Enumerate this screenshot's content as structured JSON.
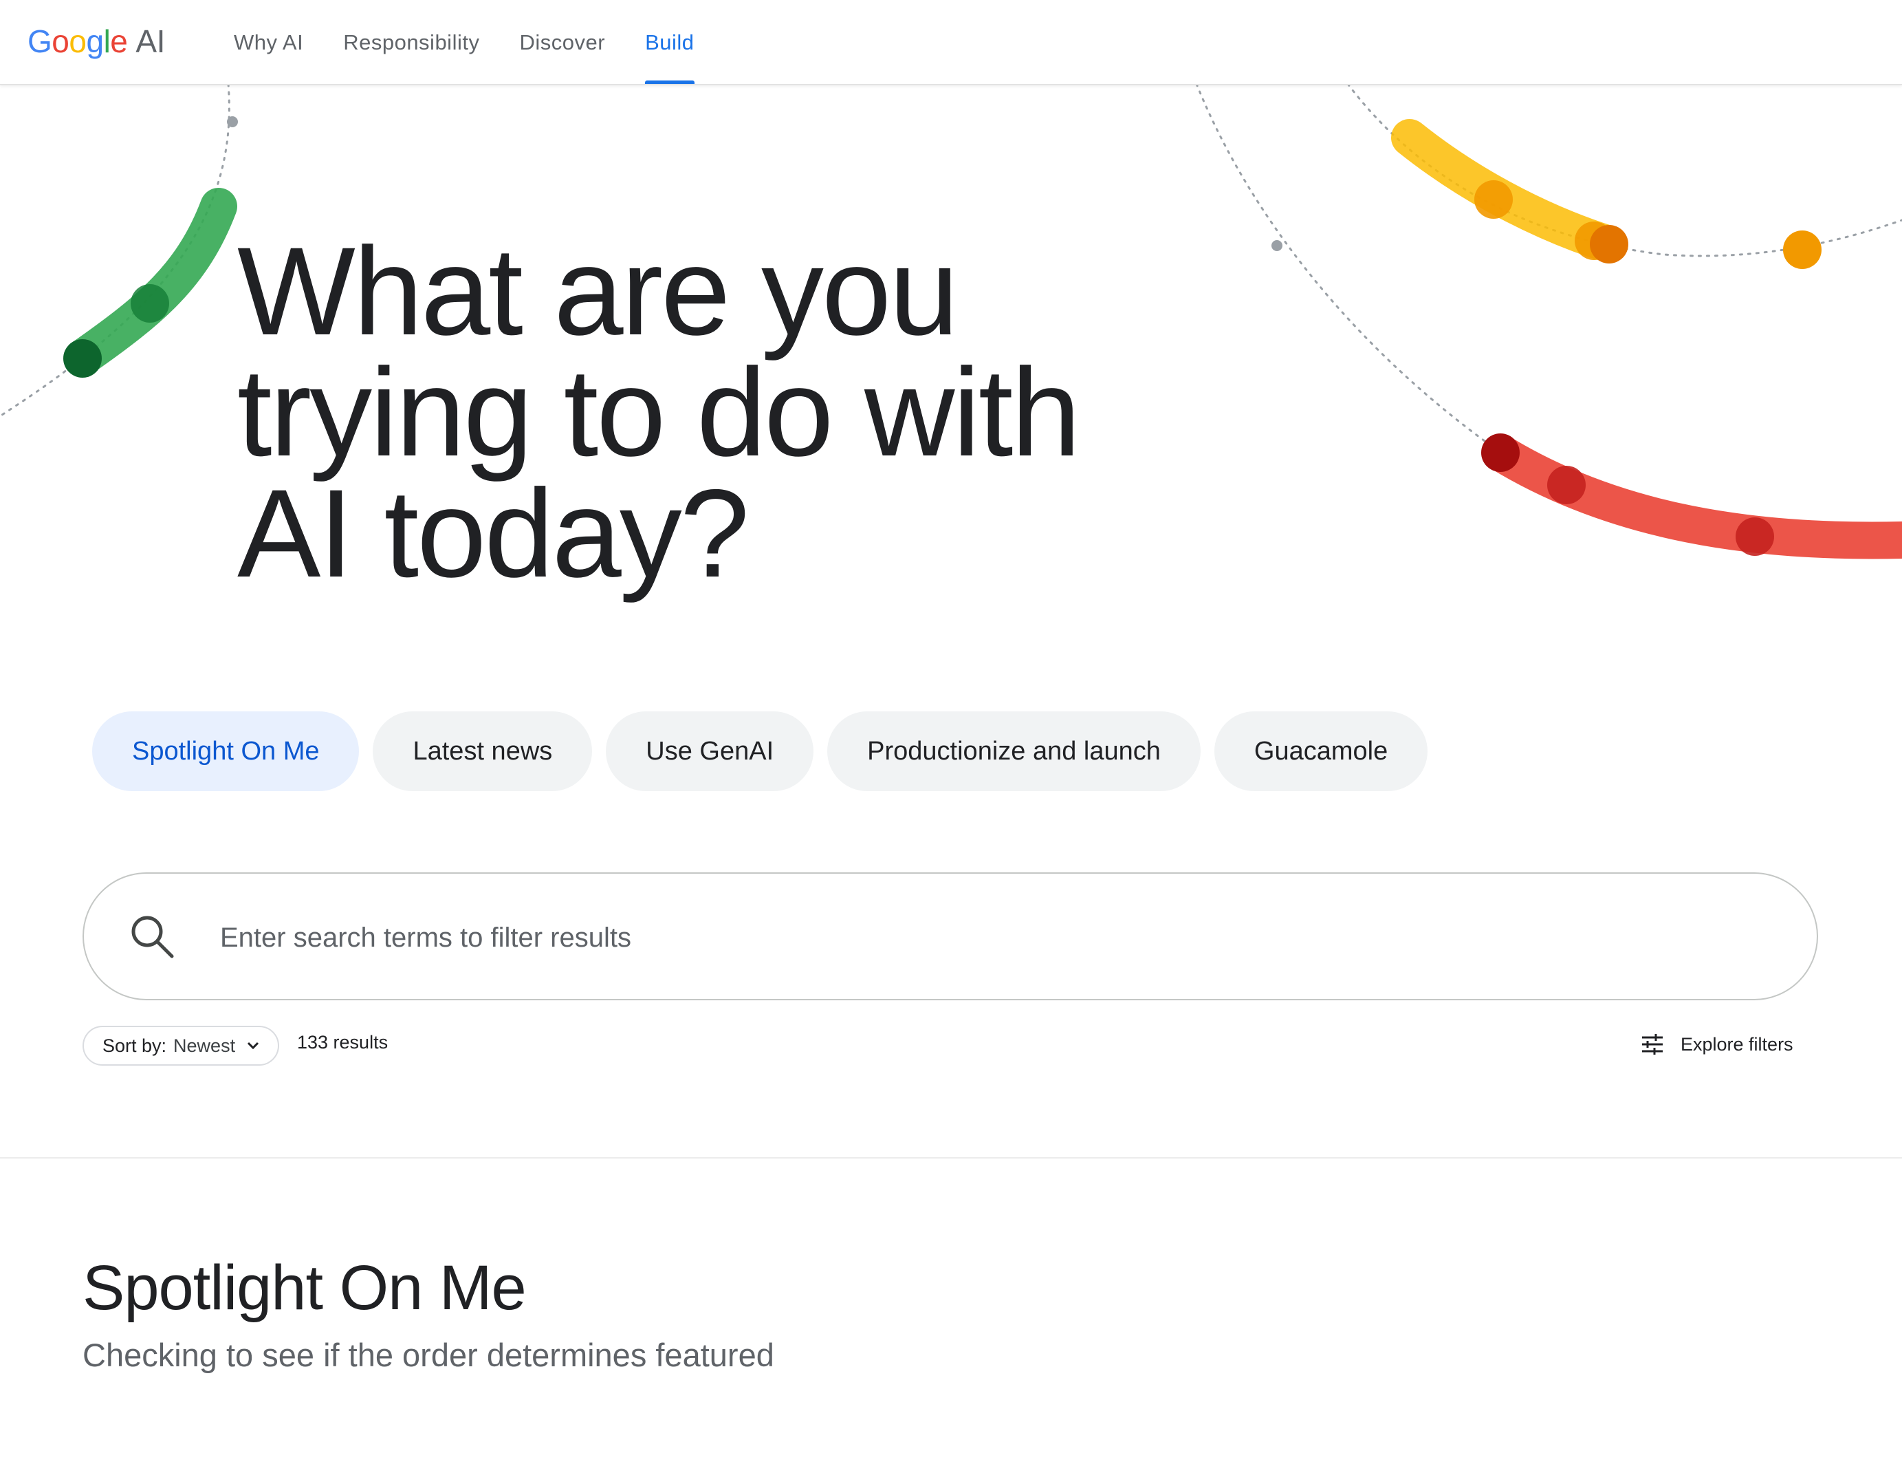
{
  "header": {
    "brand": {
      "google_letters": [
        "G",
        "o",
        "o",
        "g",
        "l",
        "e"
      ],
      "suffix": "AI"
    },
    "nav": [
      {
        "label": "Why AI",
        "active": false
      },
      {
        "label": "Responsibility",
        "active": false
      },
      {
        "label": "Discover",
        "active": false
      },
      {
        "label": "Build",
        "active": true
      }
    ],
    "colors": {
      "active_nav": "#1a73e8"
    }
  },
  "hero": {
    "title_lines": [
      "What are you",
      "trying to do with",
      "AI today?"
    ]
  },
  "chips": [
    {
      "label": "Spotlight On Me",
      "active": true
    },
    {
      "label": "Latest news",
      "active": false
    },
    {
      "label": "Use GenAI",
      "active": false
    },
    {
      "label": "Productionize and launch",
      "active": false
    },
    {
      "label": "Guacamole",
      "active": false
    }
  ],
  "search": {
    "placeholder": "Enter search terms to filter results",
    "value": "",
    "icon": "search-icon"
  },
  "toolbar": {
    "sort_label": "Sort by:",
    "sort_value": "Newest",
    "results": "133 results",
    "explore_label": "Explore filters",
    "explore_icon": "tune-icon"
  },
  "section": {
    "title": "Spotlight On Me",
    "subtitle": "Checking to see if the order determines featured"
  },
  "decor_colors": {
    "green": "#34a853",
    "yellow": "#fbbc05",
    "orange": "#e37400",
    "red": "#ea4335"
  }
}
